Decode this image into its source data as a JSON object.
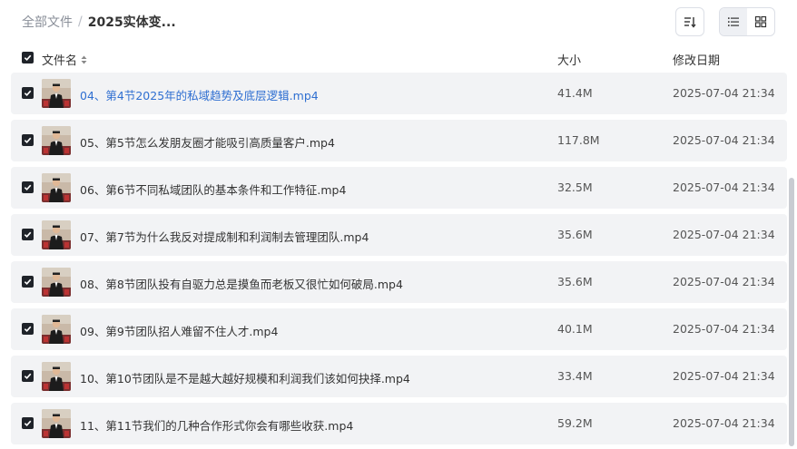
{
  "breadcrumb": {
    "root": "全部文件",
    "separator": "/",
    "current": "2025实体变..."
  },
  "header": {
    "name_label": "文件名",
    "size_label": "大小",
    "date_label": "修改日期"
  },
  "files": [
    {
      "name": "04、第4节2025年的私域趋势及底层逻辑.mp4",
      "size": "41.4M",
      "date": "2025-07-04 21:34",
      "highlighted": true
    },
    {
      "name": "05、第5节怎么发朋友圈才能吸引高质量客户.mp4",
      "size": "117.8M",
      "date": "2025-07-04 21:34",
      "highlighted": false
    },
    {
      "name": "06、第6节不同私域团队的基本条件和工作特征.mp4",
      "size": "32.5M",
      "date": "2025-07-04 21:34",
      "highlighted": false
    },
    {
      "name": "07、第7节为什么我反对提成制和利润制去管理团队.mp4",
      "size": "35.6M",
      "date": "2025-07-04 21:34",
      "highlighted": false
    },
    {
      "name": "08、第8节团队投有自驱力总是摸鱼而老板又很忙如何破局.mp4",
      "size": "35.6M",
      "date": "2025-07-04 21:34",
      "highlighted": false
    },
    {
      "name": "09、第9节团队招人难留不住人才.mp4",
      "size": "40.1M",
      "date": "2025-07-04 21:34",
      "highlighted": false
    },
    {
      "name": "10、第10节团队是不是越大越好规模和利润我们该如何抉择.mp4",
      "size": "33.4M",
      "date": "2025-07-04 21:34",
      "highlighted": false
    },
    {
      "name": "11、第11节我们的几种合作形式你会有哪些收获.mp4",
      "size": "59.2M",
      "date": "2025-07-04 21:34",
      "highlighted": false
    }
  ],
  "colors": {
    "link": "#2f6fd1",
    "row_bg": "#f2f3f5",
    "checkbox": "#1f2329"
  }
}
